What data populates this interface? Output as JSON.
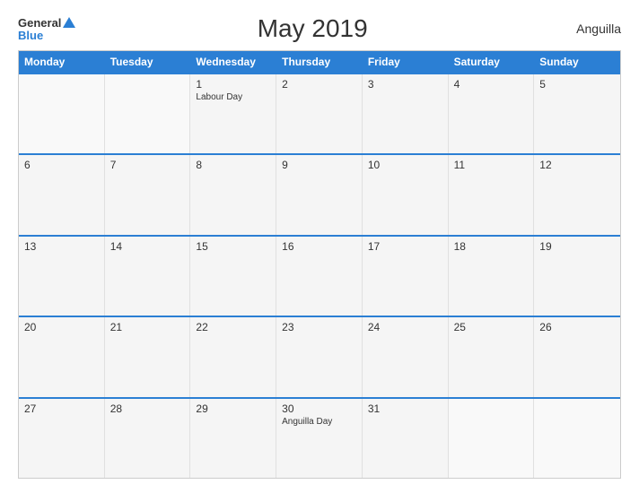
{
  "logo": {
    "general": "General",
    "blue": "Blue"
  },
  "title": "May 2019",
  "country": "Anguilla",
  "calendar": {
    "headers": [
      "Monday",
      "Tuesday",
      "Wednesday",
      "Thursday",
      "Friday",
      "Saturday",
      "Sunday"
    ],
    "weeks": [
      [
        {
          "number": "",
          "holiday": ""
        },
        {
          "number": "",
          "holiday": ""
        },
        {
          "number": "1",
          "holiday": "Labour Day"
        },
        {
          "number": "2",
          "holiday": ""
        },
        {
          "number": "3",
          "holiday": ""
        },
        {
          "number": "4",
          "holiday": ""
        },
        {
          "number": "5",
          "holiday": ""
        }
      ],
      [
        {
          "number": "6",
          "holiday": ""
        },
        {
          "number": "7",
          "holiday": ""
        },
        {
          "number": "8",
          "holiday": ""
        },
        {
          "number": "9",
          "holiday": ""
        },
        {
          "number": "10",
          "holiday": ""
        },
        {
          "number": "11",
          "holiday": ""
        },
        {
          "number": "12",
          "holiday": ""
        }
      ],
      [
        {
          "number": "13",
          "holiday": ""
        },
        {
          "number": "14",
          "holiday": ""
        },
        {
          "number": "15",
          "holiday": ""
        },
        {
          "number": "16",
          "holiday": ""
        },
        {
          "number": "17",
          "holiday": ""
        },
        {
          "number": "18",
          "holiday": ""
        },
        {
          "number": "19",
          "holiday": ""
        }
      ],
      [
        {
          "number": "20",
          "holiday": ""
        },
        {
          "number": "21",
          "holiday": ""
        },
        {
          "number": "22",
          "holiday": ""
        },
        {
          "number": "23",
          "holiday": ""
        },
        {
          "number": "24",
          "holiday": ""
        },
        {
          "number": "25",
          "holiday": ""
        },
        {
          "number": "26",
          "holiday": ""
        }
      ],
      [
        {
          "number": "27",
          "holiday": ""
        },
        {
          "number": "28",
          "holiday": ""
        },
        {
          "number": "29",
          "holiday": ""
        },
        {
          "number": "30",
          "holiday": "Anguilla Day"
        },
        {
          "number": "31",
          "holiday": ""
        },
        {
          "number": "",
          "holiday": ""
        },
        {
          "number": "",
          "holiday": ""
        }
      ]
    ]
  }
}
